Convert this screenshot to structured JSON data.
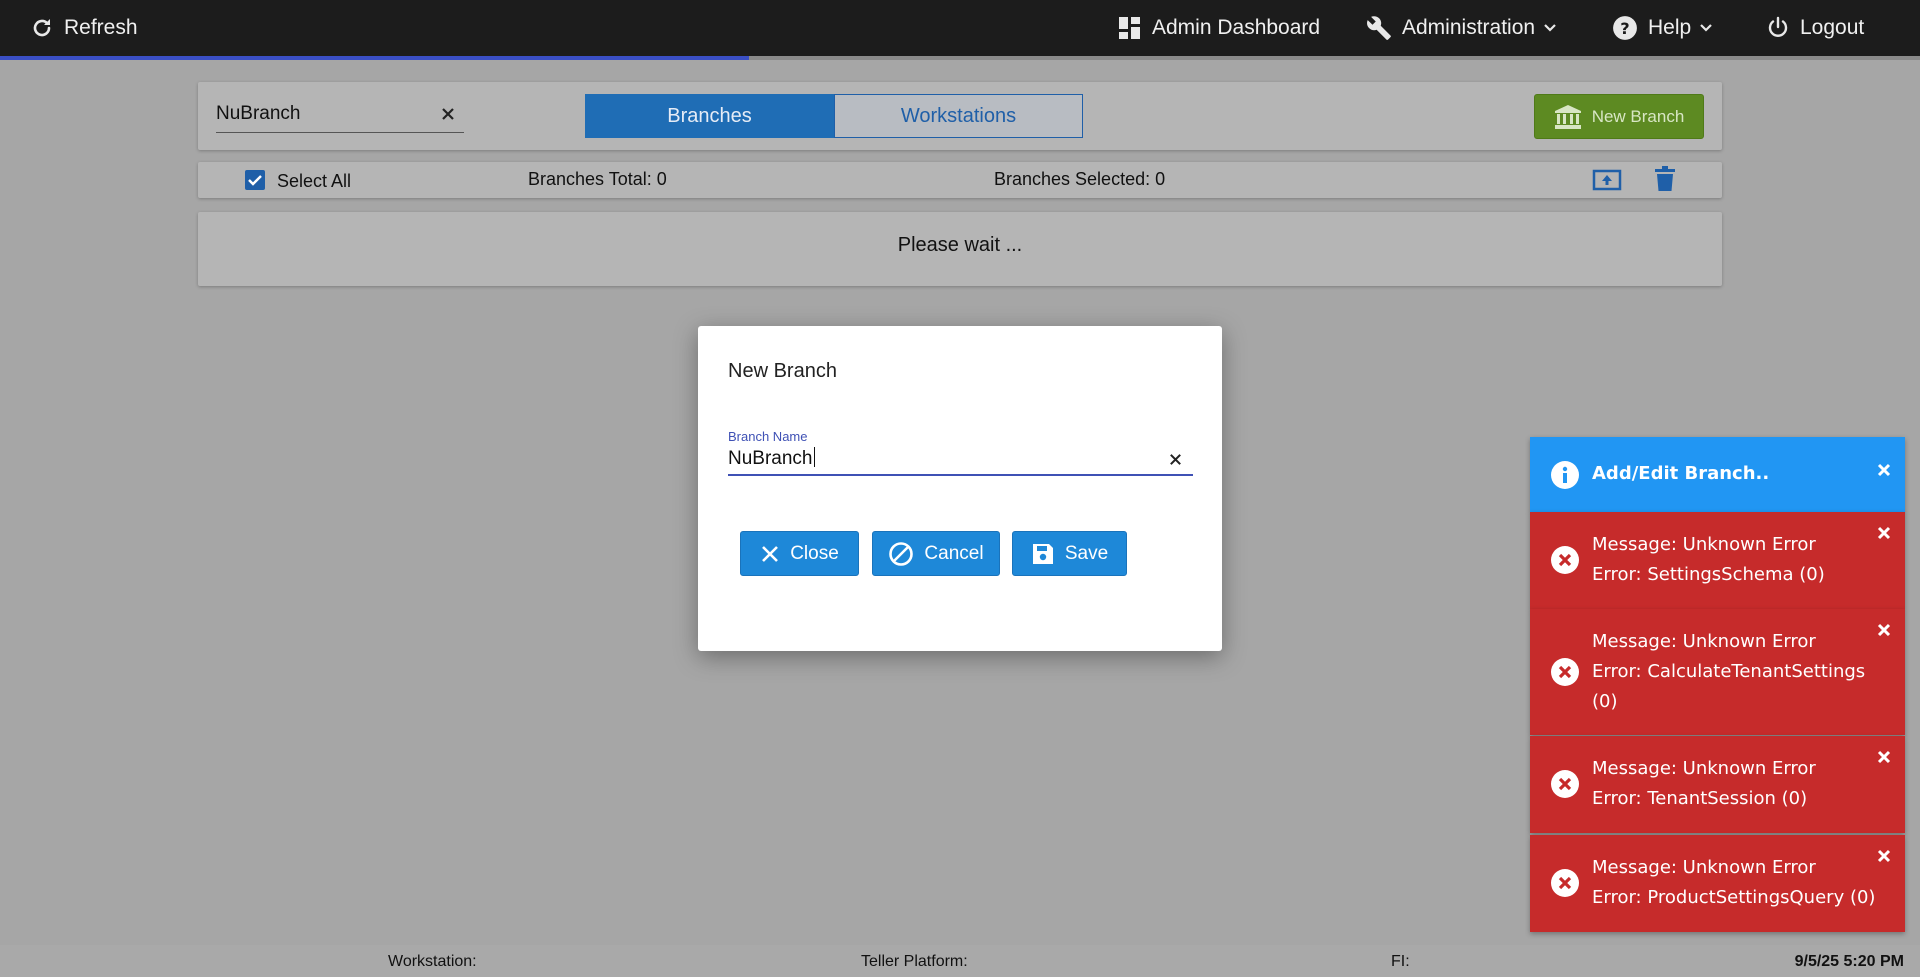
{
  "topbar": {
    "refresh_label": "Refresh",
    "admin_dashboard_label": "Admin Dashboard",
    "administration_label": "Administration",
    "help_label": "Help",
    "logout_label": "Logout",
    "progress_fraction": 0.39
  },
  "filter": {
    "value": "NuBranch"
  },
  "tabs": [
    {
      "label": "Branches",
      "active": true
    },
    {
      "label": "Workstations",
      "active": false
    }
  ],
  "new_branch_button": "New Branch",
  "list_header": {
    "select_all_label": "Select All",
    "select_all_checked": true,
    "total_text": "Branches Total: 0",
    "selected_text": "Branches Selected: 0"
  },
  "loading_text": "Please wait ...",
  "modal": {
    "title": "New Branch",
    "field_label": "Branch Name",
    "field_value": "NuBranch",
    "close_label": "Close",
    "cancel_label": "Cancel",
    "save_label": "Save"
  },
  "toasts": [
    {
      "type": "info",
      "lines": [
        "Add/Edit Branch.."
      ]
    },
    {
      "type": "error",
      "lines": [
        "Message: Unknown Error",
        "Error: SettingsSchema (0)"
      ]
    },
    {
      "type": "error",
      "lines": [
        "Message: Unknown Error",
        "Error: CalculateTenantSettings",
        "(0)"
      ]
    },
    {
      "type": "error",
      "lines": [
        "Message: Unknown Error",
        "Error: TenantSession (0)"
      ]
    },
    {
      "type": "error",
      "lines": [
        "Message: Unknown Error",
        "Error: ProductSettingsQuery (0)"
      ]
    }
  ],
  "footer": {
    "workstation_label": "Workstation:",
    "teller_platform_label": "Teller Platform:",
    "fi_label": "FI:",
    "datetime": "9/5/25 5:20 PM"
  },
  "colors": {
    "topbar_bg": "#1c1c1c",
    "progress_fill": "#3a4fc4",
    "active_tab": "#1f6db5",
    "new_branch_button": "#5d8a22",
    "modal_button": "#1e88d8",
    "toast_info": "#2196f3",
    "toast_error": "#c62b2b"
  },
  "icons": {
    "refresh": "refresh-icon",
    "admin_dashboard": "dashboard-grid-icon",
    "administration": "wrench-icon",
    "help": "question-circle-icon",
    "logout": "power-icon",
    "new_branch": "bank-icon",
    "upload": "upload-icon",
    "delete": "trash-icon",
    "close": "x-icon",
    "cancel": "ban-icon",
    "save": "floppy-disk-icon",
    "info": "info-circle-icon",
    "error": "x-circle-icon"
  }
}
